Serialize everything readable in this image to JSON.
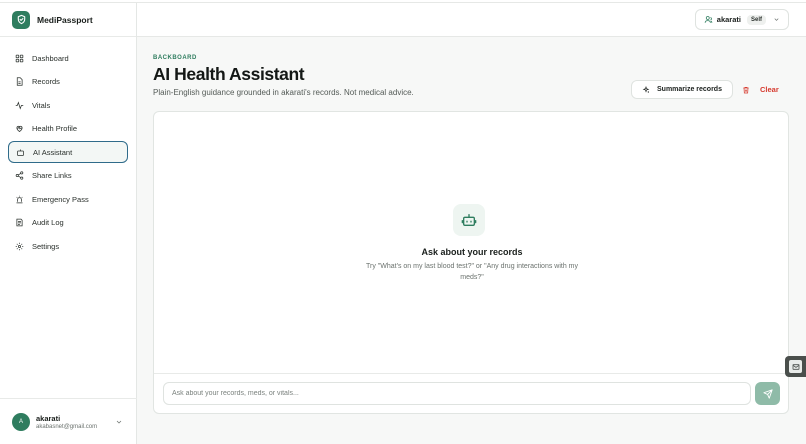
{
  "brand": {
    "name": "MediPassport"
  },
  "sidebar": {
    "items": [
      {
        "label": "Dashboard",
        "icon": "grid-icon",
        "active": false
      },
      {
        "label": "Records",
        "icon": "file-icon",
        "active": false
      },
      {
        "label": "Vitals",
        "icon": "pulse-icon",
        "active": false
      },
      {
        "label": "Health Profile",
        "icon": "heart-icon",
        "active": false
      },
      {
        "label": "AI Assistant",
        "icon": "bot-icon",
        "active": true
      },
      {
        "label": "Share Links",
        "icon": "share-icon",
        "active": false
      },
      {
        "label": "Emergency Pass",
        "icon": "siren-icon",
        "active": false
      },
      {
        "label": "Audit Log",
        "icon": "log-icon",
        "active": false
      },
      {
        "label": "Settings",
        "icon": "gear-icon",
        "active": false
      }
    ],
    "footer": {
      "avatar_initial": "A",
      "name": "akarati",
      "email": "akabasnet@gmail.com"
    }
  },
  "topbar": {
    "user_name": "akarati",
    "badge": "Self"
  },
  "main": {
    "eyebrow": "BACKBOARD",
    "title": "AI Health Assistant",
    "subtitle": "Plain-English guidance grounded in akarati's records. Not medical advice.",
    "summarize_label": "Summarize records",
    "clear_label": "Clear",
    "empty_title": "Ask about your records",
    "empty_hint": "Try \"What's on my last blood test?\" or \"Any drug interactions with my meds?\"",
    "input_placeholder": "Ask about your records, meds, or vitals..."
  },
  "colors": {
    "accent": "#2f7d5f",
    "danger": "#d63a2e",
    "active_border": "#2f6b8a",
    "send_button": "#8fbba8"
  }
}
